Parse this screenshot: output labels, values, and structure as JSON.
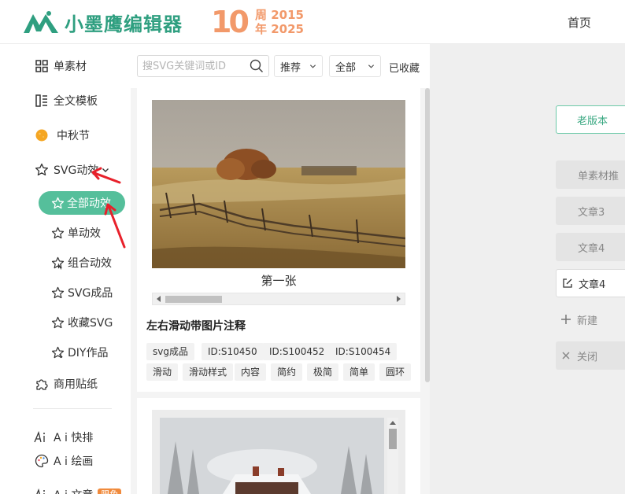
{
  "header": {
    "logo_text": "小墨鹰编辑器",
    "anniversary_number": "10",
    "anniversary_line1": "周 2015",
    "anniversary_line2": "年 2025",
    "nav_home": "首页"
  },
  "sidebar": {
    "items": [
      {
        "label": "单素材",
        "icon": "grid-icon"
      },
      {
        "label": "全文模板",
        "icon": "template-icon"
      },
      {
        "label": "中秋节",
        "icon": "moon-icon"
      },
      {
        "label": "SVG动效",
        "icon": "star-icon"
      }
    ],
    "sub_items": [
      {
        "label": "全部动效",
        "icon": "star-icon",
        "active": true
      },
      {
        "label": "单动效",
        "icon": "star-icon"
      },
      {
        "label": "组合动效",
        "icon": "star-n-icon"
      },
      {
        "label": "SVG成品",
        "icon": "star-icon"
      },
      {
        "label": "收藏SVG",
        "icon": "star-icon"
      },
      {
        "label": "DIY作品",
        "icon": "star-diy-icon"
      }
    ],
    "bottom_items": [
      {
        "label": "商用贴纸",
        "icon": "puzzle-icon"
      },
      {
        "label": "A i 快排",
        "icon": "ai-icon"
      },
      {
        "label": "A i 绘画",
        "icon": "palette-icon"
      },
      {
        "label": "A i 文章",
        "icon": "ai-icon",
        "badge": "限免"
      }
    ]
  },
  "toolbar": {
    "search_placeholder": "搜SVG关键词或ID",
    "sort_label": "推荐",
    "filter_label": "全部",
    "favorites_label": "已收藏"
  },
  "card": {
    "caption": "第一张",
    "title": "左右滑动带图片注释",
    "tags": [
      "svg成品",
      "ID:S10450",
      "ID:S100452",
      "ID:S100454",
      "滑动",
      "滑动样式",
      "内容",
      "简约",
      "极简",
      "简单",
      "圆环"
    ]
  },
  "right_panel": {
    "old_version": "老版本",
    "tabs": [
      {
        "label": "单素材推"
      },
      {
        "label": "文章3"
      },
      {
        "label": "文章4"
      },
      {
        "label": "文章4",
        "active": true
      },
      {
        "label": "新建"
      },
      {
        "label": "关闭"
      }
    ]
  },
  "colors": {
    "brand_green": "#2f9f80",
    "active_green": "#55bf9b",
    "anniversary_orange": "#f2996a",
    "arrow_red": "#e8212b"
  }
}
